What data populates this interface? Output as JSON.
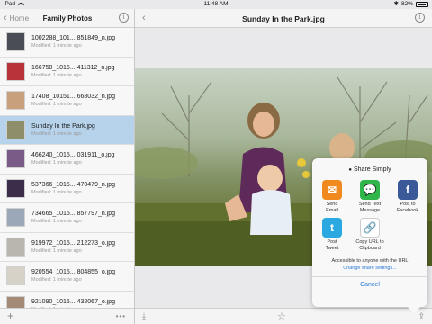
{
  "status_bar": {
    "carrier": "iPad",
    "time": "11:48 AM",
    "battery": "82%"
  },
  "sidebar": {
    "back_label": "Home",
    "title": "Family Photos",
    "files": [
      {
        "name": "1002288_101....851849_n.jpg",
        "modified": "Modified: 1 minute ago",
        "thumb": "#4a4d55",
        "selected": false
      },
      {
        "name": "166750_1015....411312_n.jpg",
        "modified": "Modified: 1 minute ago",
        "thumb": "#b8343a",
        "selected": false
      },
      {
        "name": "17408_10151....668032_n.jpg",
        "modified": "Modified: 1 minute ago",
        "thumb": "#c9a07c",
        "selected": false
      },
      {
        "name": "Sunday In the Park.jpg",
        "modified": "Modified: 1 minute ago",
        "thumb": "#8e8f6a",
        "selected": true
      },
      {
        "name": "466240_1015....031911_o.jpg",
        "modified": "Modified: 1 minute ago",
        "thumb": "#7a5a86",
        "selected": false
      },
      {
        "name": "537366_1015....470479_n.jpg",
        "modified": "Modified: 1 minute ago",
        "thumb": "#3c2e4a",
        "selected": false
      },
      {
        "name": "734665_1015....857797_n.jpg",
        "modified": "Modified: 1 minute ago",
        "thumb": "#9aa8b8",
        "selected": false
      },
      {
        "name": "919972_1015....212273_o.jpg",
        "modified": "Modified: 1 minute ago",
        "thumb": "#b9b6b0",
        "selected": false
      },
      {
        "name": "920554_1015....804855_o.jpg",
        "modified": "Modified: 1 minute ago",
        "thumb": "#d7d2c8",
        "selected": false
      },
      {
        "name": "921090_1015....432067_o.jpg",
        "modified": "Modified: 1 minute ago",
        "thumb": "#a48b78",
        "selected": false
      }
    ],
    "more_label": "•••"
  },
  "main": {
    "title": "Sunday In the Park.jpg"
  },
  "share_popover": {
    "title": "Share Simply",
    "items": [
      {
        "label_line1": "Send",
        "label_line2": "Email",
        "icon": "email-icon",
        "color": "#f08a1e",
        "glyph": "✉"
      },
      {
        "label_line1": "Send Text",
        "label_line2": "Message",
        "icon": "message-icon",
        "color": "#2fb54a",
        "glyph": "💬"
      },
      {
        "label_line1": "Post to",
        "label_line2": "Facebook",
        "icon": "facebook-icon",
        "color": "#3b5998",
        "glyph": "f"
      },
      {
        "label_line1": "Post",
        "label_line2": "Tweet",
        "icon": "twitter-icon",
        "color": "#2aa9e0",
        "glyph": "t"
      },
      {
        "label_line1": "Copy URL to",
        "label_line2": "Clipboard",
        "icon": "link-icon",
        "color": "#ffffff",
        "glyph": "🔗"
      }
    ],
    "note": "Accessible to anyone with the URL",
    "link": "Change share settings...",
    "cancel": "Cancel"
  }
}
